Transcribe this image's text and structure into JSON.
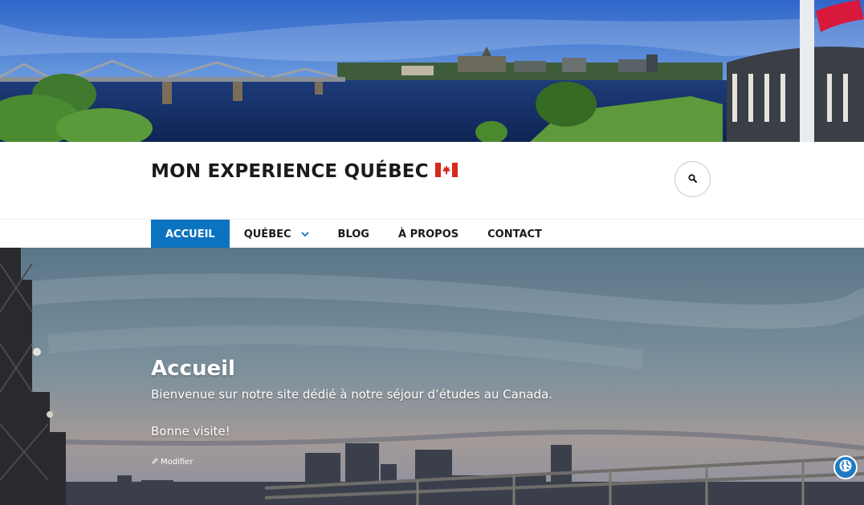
{
  "header": {
    "banner_alt": "Panorama",
    "site_title": "MON EXPERIENCE QUÉBEC",
    "flag_icon": "canada-flag-icon"
  },
  "search": {
    "icon": "search-icon"
  },
  "nav": {
    "items": [
      {
        "label": "ACCUEIL",
        "active": true
      },
      {
        "label": "QUÉBEC",
        "has_submenu": true
      },
      {
        "label": "BLOG"
      },
      {
        "label": "À PROPOS"
      },
      {
        "label": "CONTACT"
      }
    ],
    "active_color": "#0b73c0"
  },
  "hero": {
    "title": "Accueil",
    "text": "Bienvenue sur notre site dédié à notre séjour d’études au Canada.",
    "text2": "Bonne visite!",
    "edit_label": "Modifier"
  },
  "floating": {
    "icon": "globe-icon",
    "color": "#1f7bc2"
  }
}
